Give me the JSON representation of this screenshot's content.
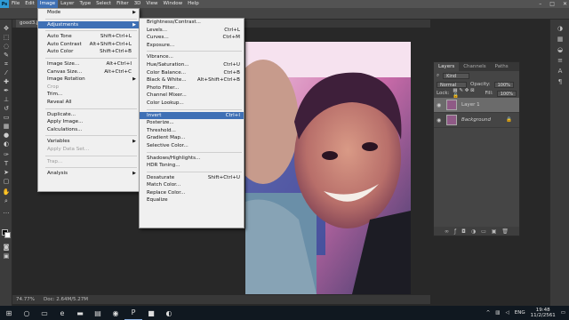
{
  "app": {
    "logo": "Ps",
    "menu": [
      "File",
      "Edit",
      "Image",
      "Layer",
      "Type",
      "Select",
      "Filter",
      "3D",
      "View",
      "Window",
      "Help"
    ],
    "active_menu": "Image",
    "window_controls": [
      "–",
      "□",
      "✕"
    ]
  },
  "document": {
    "tab_label": "good3.jp",
    "zoom": "74.77%",
    "doc_size": "Doc: 2.64M/5.27M"
  },
  "image_menu": [
    {
      "label": "Mode",
      "shortcut": "",
      "submenu": true,
      "disabled": false,
      "highlight": false
    },
    {
      "sep": true
    },
    {
      "label": "Adjustments",
      "shortcut": "",
      "submenu": true,
      "disabled": false,
      "highlight": true
    },
    {
      "sep": true
    },
    {
      "label": "Auto Tone",
      "shortcut": "Shift+Ctrl+L",
      "submenu": false,
      "disabled": false,
      "highlight": false
    },
    {
      "label": "Auto Contrast",
      "shortcut": "Alt+Shift+Ctrl+L",
      "submenu": false,
      "disabled": false,
      "highlight": false
    },
    {
      "label": "Auto Color",
      "shortcut": "Shift+Ctrl+B",
      "submenu": false,
      "disabled": false,
      "highlight": false
    },
    {
      "sep": true
    },
    {
      "label": "Image Size...",
      "shortcut": "Alt+Ctrl+I",
      "submenu": false,
      "disabled": false,
      "highlight": false
    },
    {
      "label": "Canvas Size...",
      "shortcut": "Alt+Ctrl+C",
      "submenu": false,
      "disabled": false,
      "highlight": false
    },
    {
      "label": "Image Rotation",
      "shortcut": "",
      "submenu": true,
      "disabled": false,
      "highlight": false
    },
    {
      "label": "Crop",
      "shortcut": "",
      "submenu": false,
      "disabled": true,
      "highlight": false
    },
    {
      "label": "Trim...",
      "shortcut": "",
      "submenu": false,
      "disabled": false,
      "highlight": false
    },
    {
      "label": "Reveal All",
      "shortcut": "",
      "submenu": false,
      "disabled": false,
      "highlight": false
    },
    {
      "sep": true
    },
    {
      "label": "Duplicate...",
      "shortcut": "",
      "submenu": false,
      "disabled": false,
      "highlight": false
    },
    {
      "label": "Apply Image...",
      "shortcut": "",
      "submenu": false,
      "disabled": false,
      "highlight": false
    },
    {
      "label": "Calculations...",
      "shortcut": "",
      "submenu": false,
      "disabled": false,
      "highlight": false
    },
    {
      "sep": true
    },
    {
      "label": "Variables",
      "shortcut": "",
      "submenu": true,
      "disabled": false,
      "highlight": false
    },
    {
      "label": "Apply Data Set...",
      "shortcut": "",
      "submenu": false,
      "disabled": true,
      "highlight": false
    },
    {
      "sep": true
    },
    {
      "label": "Trap...",
      "shortcut": "",
      "submenu": false,
      "disabled": true,
      "highlight": false
    },
    {
      "sep": true
    },
    {
      "label": "Analysis",
      "shortcut": "",
      "submenu": true,
      "disabled": false,
      "highlight": false
    }
  ],
  "adjustments_menu": [
    {
      "label": "Brightness/Contrast...",
      "shortcut": "",
      "highlight": false
    },
    {
      "label": "Levels...",
      "shortcut": "Ctrl+L",
      "highlight": false
    },
    {
      "label": "Curves...",
      "shortcut": "Ctrl+M",
      "highlight": false
    },
    {
      "label": "Exposure...",
      "shortcut": "",
      "highlight": false
    },
    {
      "sep": true
    },
    {
      "label": "Vibrance...",
      "shortcut": "",
      "highlight": false
    },
    {
      "label": "Hue/Saturation...",
      "shortcut": "Ctrl+U",
      "highlight": false
    },
    {
      "label": "Color Balance...",
      "shortcut": "Ctrl+B",
      "highlight": false
    },
    {
      "label": "Black & White...",
      "shortcut": "Alt+Shift+Ctrl+B",
      "highlight": false
    },
    {
      "label": "Photo Filter...",
      "shortcut": "",
      "highlight": false
    },
    {
      "label": "Channel Mixer...",
      "shortcut": "",
      "highlight": false
    },
    {
      "label": "Color Lookup...",
      "shortcut": "",
      "highlight": false
    },
    {
      "sep": true
    },
    {
      "label": "Invert",
      "shortcut": "Ctrl+I",
      "highlight": true
    },
    {
      "label": "Posterize...",
      "shortcut": "",
      "highlight": false
    },
    {
      "label": "Threshold...",
      "shortcut": "",
      "highlight": false
    },
    {
      "label": "Gradient Map...",
      "shortcut": "",
      "highlight": false
    },
    {
      "label": "Selective Color...",
      "shortcut": "",
      "highlight": false
    },
    {
      "sep": true
    },
    {
      "label": "Shadows/Highlights...",
      "shortcut": "",
      "highlight": false
    },
    {
      "label": "HDR Toning...",
      "shortcut": "",
      "highlight": false
    },
    {
      "sep": true
    },
    {
      "label": "Desaturate",
      "shortcut": "Shift+Ctrl+U",
      "highlight": false
    },
    {
      "label": "Match Color...",
      "shortcut": "",
      "highlight": false
    },
    {
      "label": "Replace Color...",
      "shortcut": "",
      "highlight": false
    },
    {
      "label": "Equalize",
      "shortcut": "",
      "highlight": false
    }
  ],
  "layers_panel": {
    "tabs": [
      "Layers",
      "Channels",
      "Paths"
    ],
    "active_tab": "Layers",
    "filter_kind": "Kind",
    "blend_mode": "Normal",
    "opacity_label": "Opacity:",
    "opacity_value": "100%",
    "lock_label": "Lock:",
    "fill_label": "Fill:",
    "fill_value": "100%",
    "layers": [
      {
        "name": "Layer 1",
        "selected": true
      },
      {
        "name": "Background",
        "selected": false
      }
    ]
  },
  "taskbar": {
    "lang": "ENG",
    "time": "19:48",
    "date": "11/2/2561"
  },
  "colors": {
    "menu_highlight": "#3f70b5",
    "photoshop_blue": "#2f9bd6"
  }
}
